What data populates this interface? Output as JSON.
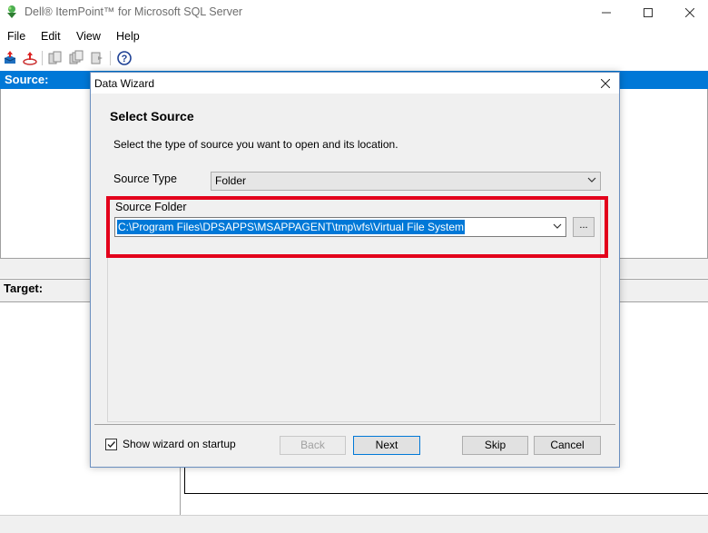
{
  "app": {
    "title": "Dell® ItemPoint™ for Microsoft SQL Server",
    "icon": "itempoint-app-icon"
  },
  "window_controls": {
    "minimize": "—",
    "maximize": "☐",
    "close": "✕"
  },
  "menu": {
    "items": [
      {
        "label": "File"
      },
      {
        "label": "Edit"
      },
      {
        "label": "View"
      },
      {
        "label": "Help"
      }
    ]
  },
  "toolbar": {
    "icons": [
      "open-source-icon",
      "open-target-icon",
      "copy-icon",
      "copy-multiple-icon",
      "export-icon",
      "help-icon"
    ]
  },
  "panels": {
    "source_label": "Source:",
    "target_label": "Target:"
  },
  "dialog": {
    "title": "Data Wizard",
    "close": "✕",
    "section_title": "Select Source",
    "description": "Select the type of source you want to open and its location.",
    "source_type_label": "Source Type",
    "source_type_value": "Folder",
    "source_folder_label": "Source Folder",
    "source_folder_value": "C:\\Program Files\\DPSAPPS\\MSAPPAGENT\\tmp\\vfs\\Virtual File System",
    "browse_label": "...",
    "show_on_startup_label": "Show wizard on startup",
    "show_on_startup_checked": true,
    "buttons": {
      "back": "Back",
      "next": "Next",
      "skip": "Skip",
      "cancel": "Cancel"
    }
  },
  "colors": {
    "accent": "#0078d7",
    "highlight_border": "#e3001b"
  }
}
